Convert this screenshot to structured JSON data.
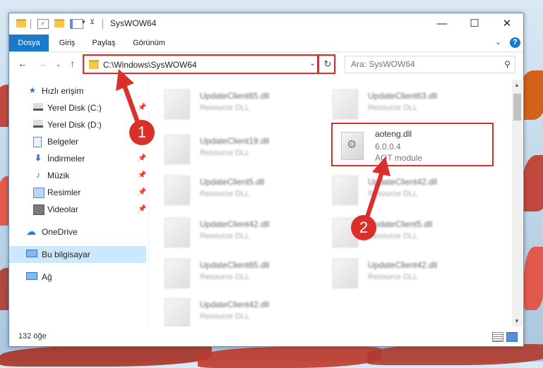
{
  "window": {
    "title": "SysWOW64",
    "controls": {
      "minimize": "—",
      "maximize": "☐",
      "close": "✕"
    }
  },
  "ribbon": {
    "tabs": [
      {
        "label": "Dosya",
        "active": true
      },
      {
        "label": "Giriş",
        "active": false
      },
      {
        "label": "Paylaş",
        "active": false
      },
      {
        "label": "Görünüm",
        "active": false
      }
    ],
    "expand_icon": "chevron-down-icon",
    "help_label": "?"
  },
  "navigation": {
    "address": "C:\\Windows\\SysWOW64",
    "search_placeholder": "Ara: SysWOW64"
  },
  "sidebar": {
    "items": [
      {
        "label": "Hızlı erişim",
        "icon": "star-icon",
        "pinned": false,
        "selected": false
      },
      {
        "label": "Yerel Disk (C:)",
        "icon": "drive-icon",
        "pinned": true,
        "selected": false
      },
      {
        "label": "Yerel Disk (D:)",
        "icon": "drive-icon",
        "pinned": true,
        "selected": false
      },
      {
        "label": "Belgeler",
        "icon": "documents-icon",
        "pinned": true,
        "selected": false
      },
      {
        "label": "İndirmeler",
        "icon": "downloads-icon",
        "pinned": true,
        "selected": false
      },
      {
        "label": "Müzik",
        "icon": "music-icon",
        "pinned": true,
        "selected": false
      },
      {
        "label": "Resimler",
        "icon": "pictures-icon",
        "pinned": true,
        "selected": false
      },
      {
        "label": "Videolar",
        "icon": "videos-icon",
        "pinned": true,
        "selected": false
      },
      {
        "label": "OneDrive",
        "icon": "cloud-icon",
        "pinned": false,
        "selected": false
      },
      {
        "label": "Bu bilgisayar",
        "icon": "computer-icon",
        "pinned": false,
        "selected": true
      },
      {
        "label": "Ağ",
        "icon": "network-icon",
        "pinned": false,
        "selected": false
      }
    ]
  },
  "files": [
    {
      "name": "UpdateClient65.dll",
      "desc": "Resource DLL"
    },
    {
      "name": "UpdateClient63.dll",
      "desc": "Resource DLL"
    },
    {
      "name": "UpdateClient19.dll",
      "desc": "Resource DLL"
    },
    {
      "name": "aoteng.dll",
      "version": "6.0.0.4",
      "desc": "AOT module"
    },
    {
      "name": "UpdateClient5.dll",
      "desc": "Resource DLL"
    },
    {
      "name": "UpdateClient42.dll",
      "desc": "Resource DLL"
    },
    {
      "name": "UpdateClient42.dll",
      "desc": "Resource DLL"
    },
    {
      "name": "UpdateClient5.dll",
      "desc": "Resource DLL"
    },
    {
      "name": "UpdateClient65.dll",
      "desc": "Resource DLL"
    },
    {
      "name": "UpdateClient42.dll",
      "desc": "Resource DLL"
    },
    {
      "name": "UpdateClient42.dll",
      "desc": "Resource DLL"
    }
  ],
  "status": {
    "item_count": "132 öğe"
  },
  "annotations": {
    "step1": "1",
    "step2": "2",
    "highlight_color": "#d9302c"
  }
}
